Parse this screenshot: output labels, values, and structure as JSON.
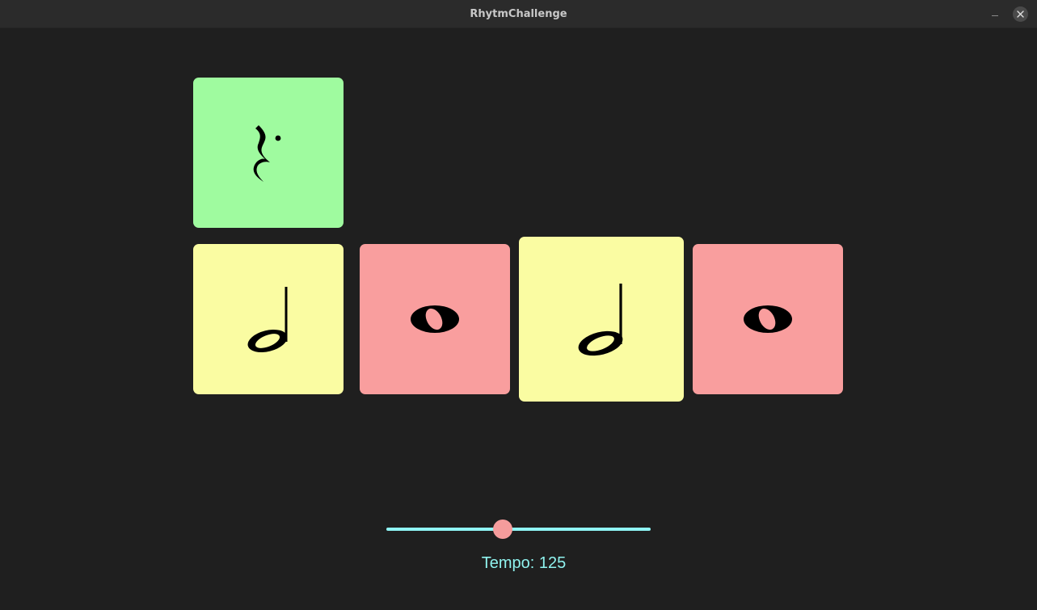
{
  "window": {
    "title": "RhytmChallenge"
  },
  "colors": {
    "background": "#1f1f1f",
    "card_green": "#9ffb9f",
    "card_yellow": "#fafca2",
    "card_red": "#f99e9e",
    "slider_track": "#8ff5f5",
    "slider_thumb": "#f59c9c",
    "tempo_text": "#8ff2ee"
  },
  "cards": [
    {
      "row": 1,
      "symbol": "quarter-rest",
      "color": "green"
    },
    {
      "row": 2,
      "symbol": "half-note",
      "color": "yellow"
    },
    {
      "row": 2,
      "symbol": "whole-note",
      "color": "red"
    },
    {
      "row": 2,
      "symbol": "half-note",
      "color": "yellow",
      "state": "enlarged"
    },
    {
      "row": 2,
      "symbol": "whole-note",
      "color": "red"
    }
  ],
  "tempo": {
    "label": "Tempo: 125",
    "value": 125,
    "slider_fraction": 0.44
  }
}
